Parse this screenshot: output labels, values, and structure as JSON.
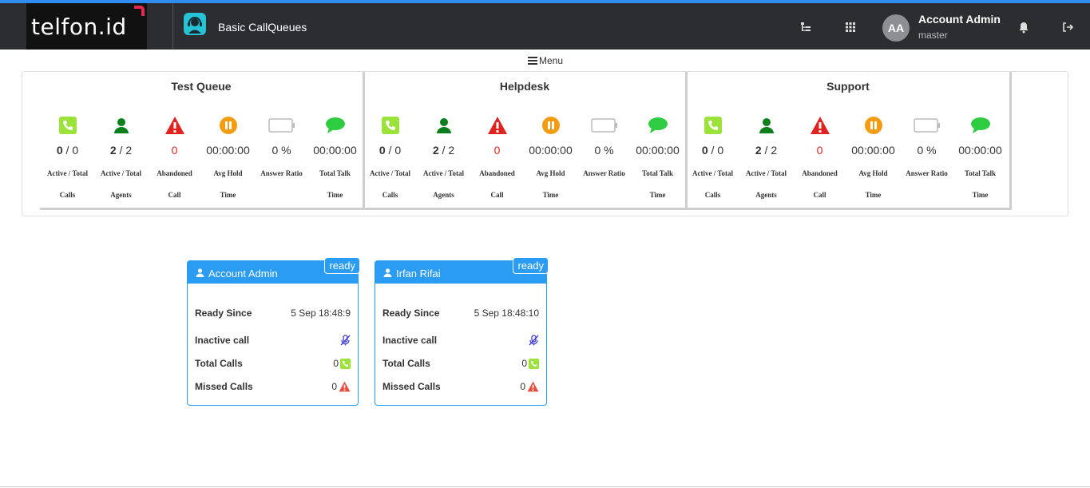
{
  "header": {
    "logo_text": "telfon.id",
    "app_title": "Basic CallQueues",
    "avatar_initials": "AA",
    "user_name": "Account Admin",
    "user_role": "master",
    "icons": [
      "sitemap-icon",
      "grid-icon",
      "bell-icon",
      "logout-icon"
    ]
  },
  "menu": {
    "label": "Menu"
  },
  "queues": [
    {
      "name": "Test Queue",
      "calls_active": "0",
      "calls_total": "0",
      "agents_active": "2",
      "agents_total": "2",
      "abandoned": "0",
      "avg_hold": "00:00:00",
      "answer_ratio": "0 %",
      "total_talk": "00:00:00"
    },
    {
      "name": "Helpdesk",
      "calls_active": "0",
      "calls_total": "0",
      "agents_active": "2",
      "agents_total": "2",
      "abandoned": "0",
      "avg_hold": "00:00:00",
      "answer_ratio": "0 %",
      "total_talk": "00:00:00"
    },
    {
      "name": "Support",
      "calls_active": "0",
      "calls_total": "0",
      "agents_active": "2",
      "agents_total": "2",
      "abandoned": "0",
      "avg_hold": "00:00:00",
      "answer_ratio": "0 %",
      "total_talk": "00:00:00"
    }
  ],
  "stat_labels": {
    "calls_l1": "Active / Total",
    "calls_l2": "Calls",
    "agents_l1": "Active / Total",
    "agents_l2": "Agents",
    "abandoned_l1": "Abandoned",
    "abandoned_l2": "Call",
    "hold_l1": "Avg Hold",
    "hold_l2": "Time",
    "ratio_l1": "Answer Ratio",
    "talk_l1": "Total Talk",
    "talk_l2": "Time",
    "separator": "/"
  },
  "agent_labels": {
    "ready_since": "Ready Since",
    "inactive_call": "Inactive call",
    "total_calls": "Total Calls",
    "missed_calls": "Missed Calls"
  },
  "agents": [
    {
      "name": "Account Admin",
      "status": "ready",
      "ready_since": "5 Sep 18:48:9",
      "total_calls": "0",
      "missed_calls": "0"
    },
    {
      "name": "Irfan Rifai",
      "status": "ready",
      "ready_since": "5 Sep 18:48:10",
      "total_calls": "0",
      "missed_calls": "0"
    }
  ],
  "colors": {
    "navbar": "#2b2d30",
    "accent": "#2b9cf4",
    "phone_green": "#9be23a",
    "agent_green": "#0a7d1c",
    "alert_red": "#e0231f",
    "hold_orange": "#f39c12",
    "chat_green": "#2ecc40"
  }
}
